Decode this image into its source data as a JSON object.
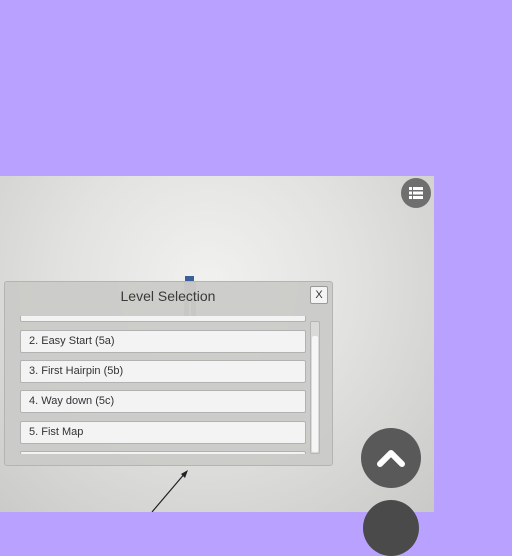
{
  "panel": {
    "title": "Level Selection",
    "close_label": "X",
    "items": [
      {
        "label": ""
      },
      {
        "label": "2. Easy Start (5a)"
      },
      {
        "label": "3. First Hairpin (5b)"
      },
      {
        "label": "4. Way down (5c)"
      },
      {
        "label": "5. Fist Map"
      },
      {
        "label": ""
      }
    ]
  },
  "icons": {
    "menu": "list-icon",
    "up": "chevron-up-icon"
  },
  "colors": {
    "background": "#b8a1ff",
    "button_dark": "#595959"
  }
}
